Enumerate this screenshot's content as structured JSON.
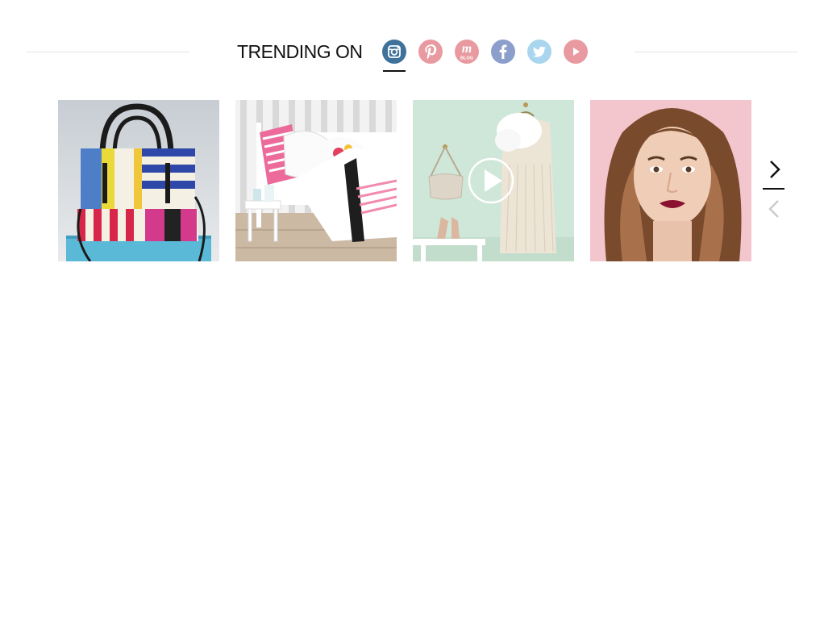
{
  "trending": {
    "title": "TRENDING ON",
    "networks": [
      {
        "name": "instagram",
        "active": true,
        "color": "#3f729b"
      },
      {
        "name": "pinterest",
        "active": false,
        "color": "#e89aa0"
      },
      {
        "name": "macys-blog",
        "active": false,
        "color": "#e89aa0",
        "icon_text": "m",
        "icon_subtext": "BLOG"
      },
      {
        "name": "facebook",
        "active": false,
        "color": "#8c9fcc"
      },
      {
        "name": "twitter",
        "active": false,
        "color": "#a9d5ef"
      },
      {
        "name": "youtube",
        "active": false,
        "color": "#e89aa0"
      }
    ]
  },
  "carousel": {
    "items": [
      {
        "subject": "striped handbag",
        "has_video": false
      },
      {
        "subject": "striped bedding",
        "has_video": false
      },
      {
        "subject": "fringe dress with bag and heels",
        "has_video": true
      },
      {
        "subject": "beauty portrait",
        "has_video": false
      }
    ],
    "controls": {
      "next": "chevron-right-icon",
      "previous": "chevron-left-icon"
    }
  },
  "colors": {
    "rule": "#e6e6e6",
    "text": "#111111",
    "arrow_disabled": "#cccccc"
  }
}
